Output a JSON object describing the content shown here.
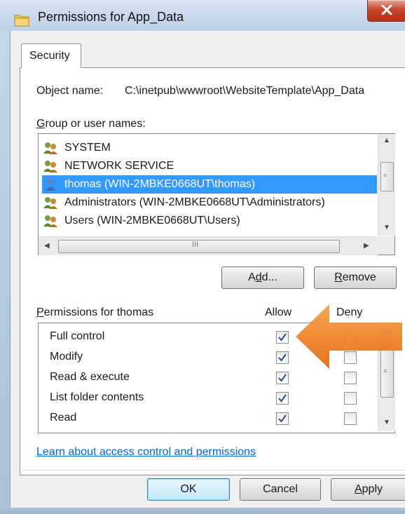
{
  "window": {
    "title": "Permissions for App_Data"
  },
  "tabs": [
    {
      "label": "Security",
      "selected": true
    }
  ],
  "object_name": {
    "label": "Object name:",
    "value": "C:\\inetpub\\wwwroot\\WebsiteTemplate\\App_Data"
  },
  "users": {
    "label_pre": "",
    "label_u": "G",
    "label_post": "roup or user names:",
    "items": [
      {
        "name": "SYSTEM",
        "icon": "group-icon",
        "selected": false
      },
      {
        "name": "NETWORK SERVICE",
        "icon": "group-icon",
        "selected": false
      },
      {
        "name": "thomas (WIN-2MBKE0668UT\\thomas)",
        "icon": "user-icon",
        "selected": true
      },
      {
        "name": "Administrators (WIN-2MBKE0668UT\\Administrators)",
        "icon": "group-icon",
        "selected": false
      },
      {
        "name": "Users (WIN-2MBKE0668UT\\Users)",
        "icon": "group-icon",
        "selected": false
      }
    ],
    "scroll_thumb_label": "III"
  },
  "buttons": {
    "add_pre": "A",
    "add_u": "d",
    "add_post": "d...",
    "remove_u": "R",
    "remove_post": "emove",
    "ok": "OK",
    "cancel": "Cancel",
    "apply_u": "A",
    "apply_post": "pply"
  },
  "permissions": {
    "label_u": "P",
    "label_post": "ermissions for thomas",
    "allow_header": "Allow",
    "deny_header": "Deny",
    "rows": [
      {
        "name": "Full control",
        "allow": true,
        "deny": false
      },
      {
        "name": "Modify",
        "allow": true,
        "deny": false
      },
      {
        "name": "Read & execute",
        "allow": true,
        "deny": false
      },
      {
        "name": "List folder contents",
        "allow": true,
        "deny": false
      },
      {
        "name": "Read",
        "allow": true,
        "deny": false
      }
    ]
  },
  "link": {
    "text": "Learn about access control and permissions"
  },
  "colors": {
    "selection": "#3399ff",
    "link": "#0066cc",
    "arrow": "#f07a1a"
  }
}
